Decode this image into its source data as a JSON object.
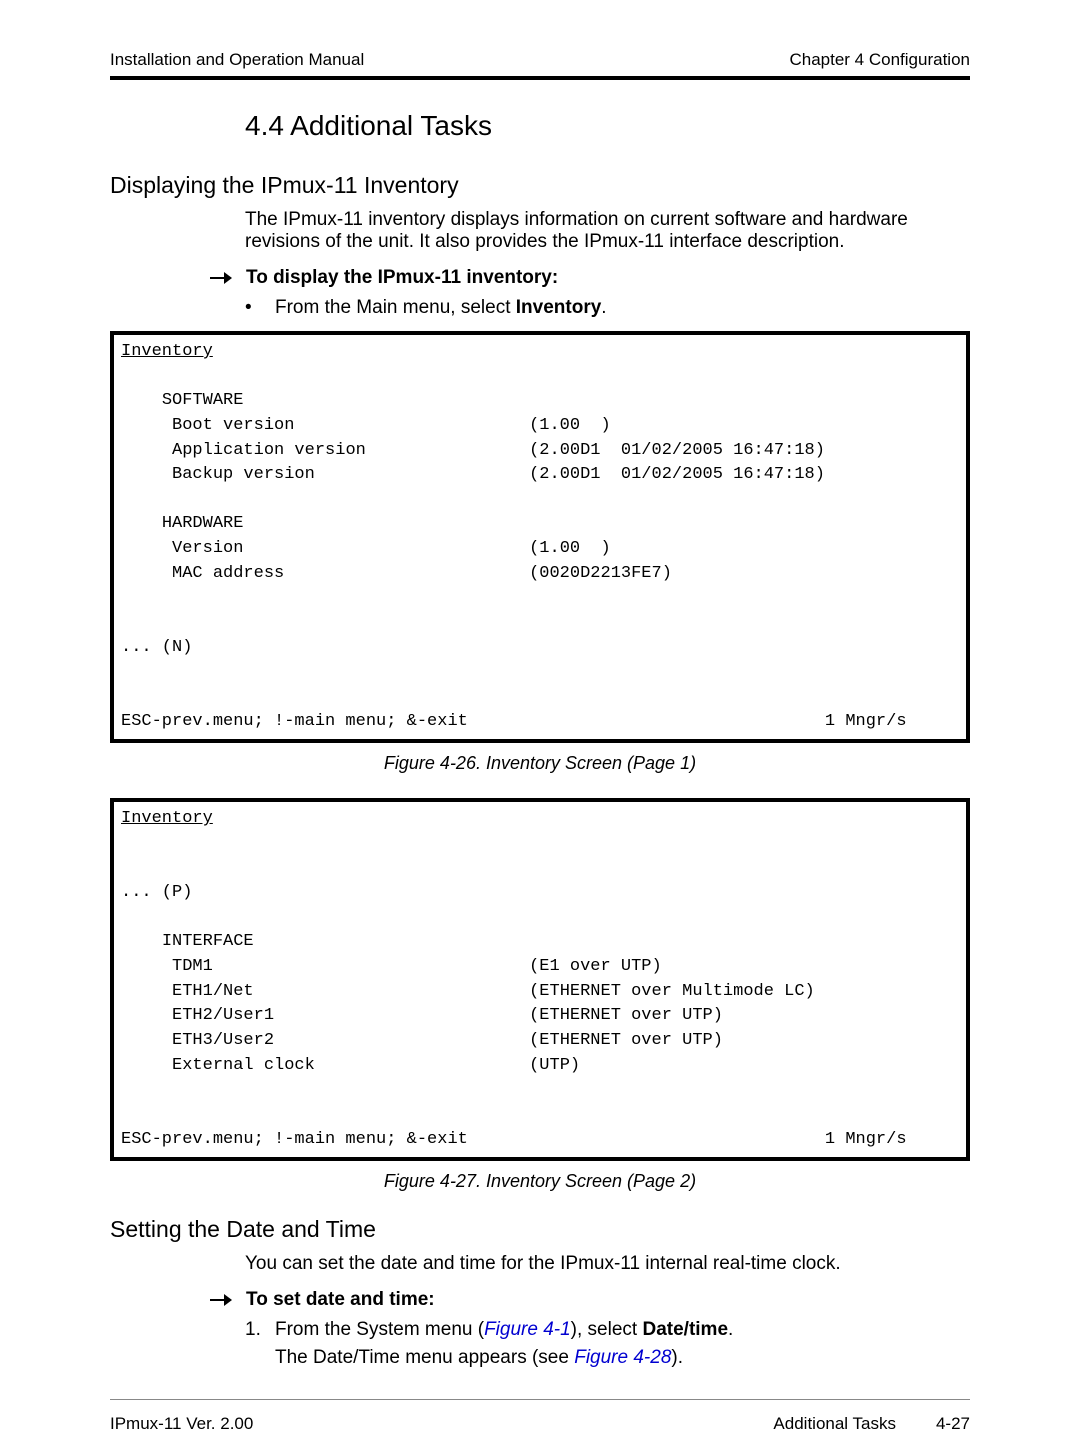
{
  "header": {
    "left": "Installation and Operation Manual",
    "right": "Chapter 4  Configuration"
  },
  "section_number_title": "4.4  Additional Tasks",
  "sub1": {
    "heading": "Displaying the IPmux-11 Inventory",
    "para": "The IPmux-11 inventory displays information on current software and hardware revisions of the unit. It also provides the IPmux-11 interface description.",
    "arrow_label": "To display the IPmux-11 inventory:",
    "bullet_prefix": "From the Main menu, select ",
    "bullet_bold": "Inventory",
    "bullet_suffix": "."
  },
  "screen1": {
    "title": "Inventory",
    "software_label": "SOFTWARE",
    "boot_label": "Boot version",
    "boot_val": "(1.00  )",
    "app_label": "Application version",
    "app_val": "(2.00D1  01/02/2005 16:47:18)",
    "backup_label": "Backup version",
    "backup_val": "(2.00D1  01/02/2005 16:47:18)",
    "hardware_label": "HARDWARE",
    "hw_ver_label": "Version",
    "hw_ver_val": "(1.00  )",
    "mac_label": "MAC address",
    "mac_val": "(0020D2213FE7)",
    "next": "... (N)",
    "footer_left": "ESC-prev.menu; !-main menu; &-exit",
    "footer_right": "1 Mngr/s"
  },
  "caption1": "Figure 4-26.  Inventory Screen (Page 1)",
  "screen2": {
    "title": "Inventory",
    "prev": "... (P)",
    "iface_label": "INTERFACE",
    "tdm_label": "TDM1",
    "tdm_val": "(E1 over UTP)",
    "eth1_label": "ETH1/Net",
    "eth1_val": "(ETHERNET over Multimode LC)",
    "eth2_label": "ETH2/User1",
    "eth2_val": "(ETHERNET over UTP)",
    "eth3_label": "ETH3/User2",
    "eth3_val": "(ETHERNET over UTP)",
    "clk_label": "External clock",
    "clk_val": "(UTP)",
    "footer_left": "ESC-prev.menu; !-main menu; &-exit",
    "footer_right": "1 Mngr/s"
  },
  "caption2": "Figure 4-27.  Inventory Screen (Page 2)",
  "sub2": {
    "heading": "Setting the Date and Time",
    "para": "You can set the date and time for the IPmux-11 internal real-time clock.",
    "arrow_label": "To set date and time:",
    "step1_prefix": "From the System menu (",
    "step1_link": "Figure 4-1",
    "step1_mid": "), select ",
    "step1_bold": "Date/time",
    "step1_suffix": ".",
    "cont_prefix": "The Date/Time menu appears (see ",
    "cont_link": "Figure 4-28",
    "cont_suffix": ")."
  },
  "footer": {
    "left": "IPmux-11 Ver. 2.00",
    "right_label": "Additional Tasks",
    "pagenum": "4-27"
  }
}
